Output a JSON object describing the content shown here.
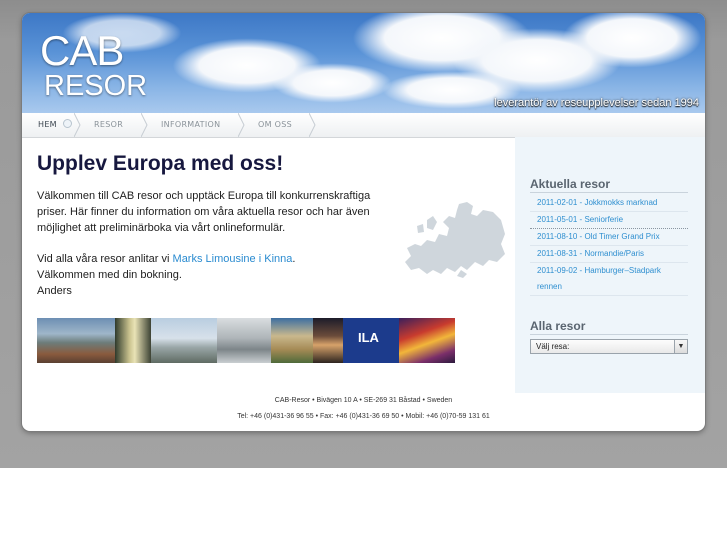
{
  "header": {
    "logo_line1": "CAB",
    "logo_line2": "RESOR",
    "tagline": "leverantör av reseupplevelser sedan 1994"
  },
  "nav": {
    "items": [
      {
        "label": "HEM",
        "active": true
      },
      {
        "label": "RESOR",
        "active": false
      },
      {
        "label": "INFORMATION",
        "active": false
      },
      {
        "label": "OM OSS",
        "active": false
      }
    ]
  },
  "main": {
    "title": "Upplev Europa med oss!",
    "intro": "Välkommen till CAB resor och upptäck Europa till konkurrenskraftiga priser. Här finner du information om våra aktuella resor och har även möjlighet att preliminärboka via vårt onlineformulär.",
    "p2_before": "Vid alla våra resor anlitar vi ",
    "p2_link": "Marks Limousine i Kinna",
    "p2_after": ".",
    "p3": "Välkommen med din bokning.",
    "signature": "Anders",
    "photo_badge": "ILA"
  },
  "sidebar": {
    "current_title": "Aktuella resor",
    "trips": [
      "2011-02-01 - Jokkmokks marknad",
      "2011-05-01 - Seniorferie",
      "2011-08-10 - Old Timer Grand Prix",
      "2011-08-31 - Normandie/Paris",
      "2011-09-02 - Hamburger–Stadpark rennen"
    ],
    "all_title": "Alla resor",
    "select_value": "Välj resa:"
  },
  "footer": {
    "address": "CAB-Resor • Bivägen 10 A • SE-269 31 Båstad • Sweden",
    "phones": "Tel: +46 (0)431-36 96 55 • Fax: +46 (0)431-36 69 50 • Mobil: +46 (0)70-59 131 61"
  },
  "colors": {
    "title": "#17183f",
    "link": "#2a8bd0",
    "sidebar_bg": "#eef5fa"
  }
}
